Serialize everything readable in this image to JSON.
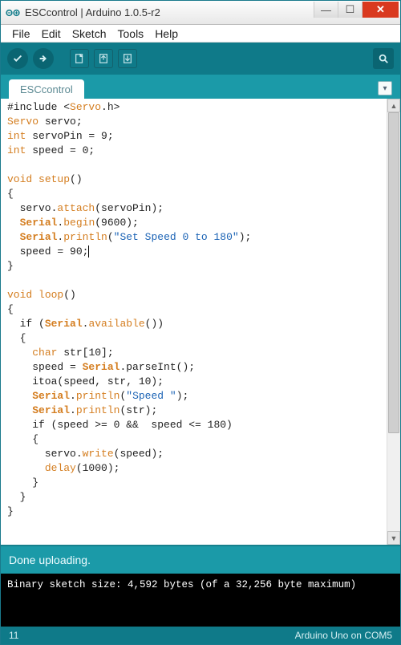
{
  "window": {
    "title": "ESCcontrol | Arduino 1.0.5-r2"
  },
  "menubar": {
    "file": "File",
    "edit": "Edit",
    "sketch": "Sketch",
    "tools": "Tools",
    "help": "Help"
  },
  "tab": {
    "name": "ESCcontrol",
    "dropdown_glyph": "▾"
  },
  "toolbar_icons": {
    "verify": "verify",
    "upload": "upload",
    "new": "new",
    "open": "open",
    "save": "save",
    "monitor": "serial-monitor"
  },
  "code": {
    "l1a": "#include <",
    "l1b": "Servo",
    "l1c": ".h>",
    "l2a": "Servo",
    "l2b": " servo;",
    "l3a": "int",
    "l3b": " servoPin = 9;",
    "l4a": "int",
    "l4b": " speed = 0;",
    "l5": "",
    "l6a": "void ",
    "l6b": "setup",
    "l6c": "()",
    "l7": "{",
    "l8a": "  servo.",
    "l8b": "attach",
    "l8c": "(servoPin);",
    "l9a": "  ",
    "l9b": "Serial",
    "l9c": ".",
    "l9d": "begin",
    "l9e": "(9600);",
    "l10a": "  ",
    "l10b": "Serial",
    "l10c": ".",
    "l10d": "println",
    "l10e": "(",
    "l10f": "\"Set Speed 0 to 180\"",
    "l10g": ");",
    "l11a": "  speed = 90;",
    "l12": "}",
    "l13": "",
    "l14a": "void ",
    "l14b": "loop",
    "l14c": "()",
    "l15": "{",
    "l16a": "  if (",
    "l16b": "Serial",
    "l16c": ".",
    "l16d": "available",
    "l16e": "())",
    "l17": "  {",
    "l18a": "    ",
    "l18b": "char",
    "l18c": " str[10];",
    "l19a": "    speed = ",
    "l19b": "Serial",
    "l19c": ".parseInt();",
    "l20": "    itoa(speed, str, 10);",
    "l21a": "    ",
    "l21b": "Serial",
    "l21c": ".",
    "l21d": "println",
    "l21e": "(",
    "l21f": "\"Speed \"",
    "l21g": ");",
    "l22a": "    ",
    "l22b": "Serial",
    "l22c": ".",
    "l22d": "println",
    "l22e": "(str);",
    "l23a": "    if (speed >= 0 &&  speed <= 180)",
    "l24": "    {",
    "l25a": "      servo.",
    "l25b": "write",
    "l25c": "(speed);",
    "l26a": "      ",
    "l26b": "delay",
    "l26c": "(1000);",
    "l27": "    }",
    "l28": "  }",
    "l29": "}"
  },
  "status": {
    "message": "Done uploading."
  },
  "console": {
    "line1": "Binary sketch size: 4,592 bytes (of a 32,256 byte maximum)"
  },
  "footer": {
    "line": "11",
    "board": "Arduino Uno on COM5"
  },
  "scroll": {
    "up": "▲",
    "down": "▼"
  }
}
